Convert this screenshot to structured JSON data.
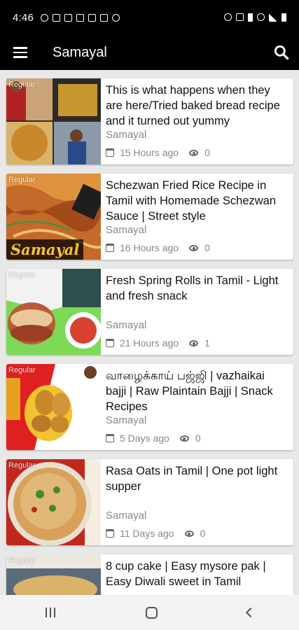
{
  "status_bar": {
    "time": "4:46"
  },
  "app_bar": {
    "title": "Samayal"
  },
  "videos": [
    {
      "label": "Regular",
      "title": "This is what happens when they are here/Tried baked bread recipe and it turned out yummy",
      "channel": "Samayal",
      "age": "15 Hours ago",
      "views": "0"
    },
    {
      "label": "Regular",
      "watermark": "Samayal",
      "title": "Schezwan Fried Rice Recipe in Tamil with Homemade Schezwan Sauce | Street style",
      "channel": "Samayal",
      "age": "16 Hours ago",
      "views": "0"
    },
    {
      "label": "Regular",
      "title": "Fresh Spring Rolls in Tamil - Light and fresh snack",
      "channel": "Samayal",
      "age": "21 Hours ago",
      "views": "1"
    },
    {
      "label": "Regular",
      "title": "வாழைக்காய் பஜ்ஜி | vazhaikai bajji | Raw Plaintain Bajji | Snack Recipes",
      "channel": "Samayal",
      "age": "5 Days ago",
      "views": "0"
    },
    {
      "label": "Regular",
      "title": "Rasa Oats in Tamil | One pot light supper",
      "channel": "Samayal",
      "age": "11 Days ago",
      "views": "0"
    },
    {
      "label": "Regular",
      "title": "8 cup cake | Easy mysore pak | Easy Diwali sweet in Tamil",
      "channel": "",
      "age": "",
      "views": ""
    }
  ],
  "colors": {
    "app_bar": "#000000",
    "background": "#e8e8e8",
    "card": "#ffffff",
    "meta": "#888888"
  },
  "icons": [
    "menu-icon",
    "search-icon",
    "calendar-icon",
    "eye-icon",
    "nav-recent-icon",
    "nav-home-icon",
    "nav-back-icon"
  ]
}
